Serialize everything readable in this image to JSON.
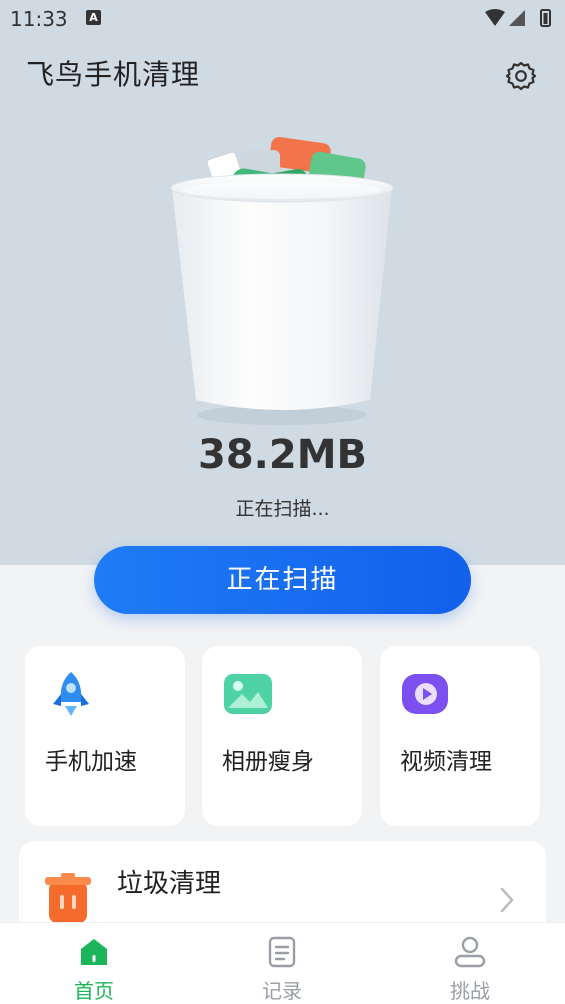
{
  "status_bar": {
    "time": "11:33",
    "notification_badge": "A"
  },
  "header": {
    "title": "飞鸟手机清理"
  },
  "scan": {
    "size": "38.2MB",
    "status": "正在扫描...",
    "button_label": "正在扫描"
  },
  "features": [
    {
      "label": "手机加速",
      "icon": "rocket-icon"
    },
    {
      "label": "相册瘦身",
      "icon": "photo-icon"
    },
    {
      "label": "视频清理",
      "icon": "video-icon"
    }
  ],
  "junk": {
    "title": "垃圾清理",
    "icon": "trash-icon"
  },
  "tabs": [
    {
      "label": "首页",
      "icon": "home-icon",
      "active": true
    },
    {
      "label": "记录",
      "icon": "document-icon",
      "active": false
    },
    {
      "label": "挑战",
      "icon": "user-icon",
      "active": false
    }
  ],
  "colors": {
    "accent": "#1a6ff0",
    "active_tab": "#1db55a",
    "inactive_tab": "#9a9ea6",
    "header_bg": "#cfdae3"
  }
}
